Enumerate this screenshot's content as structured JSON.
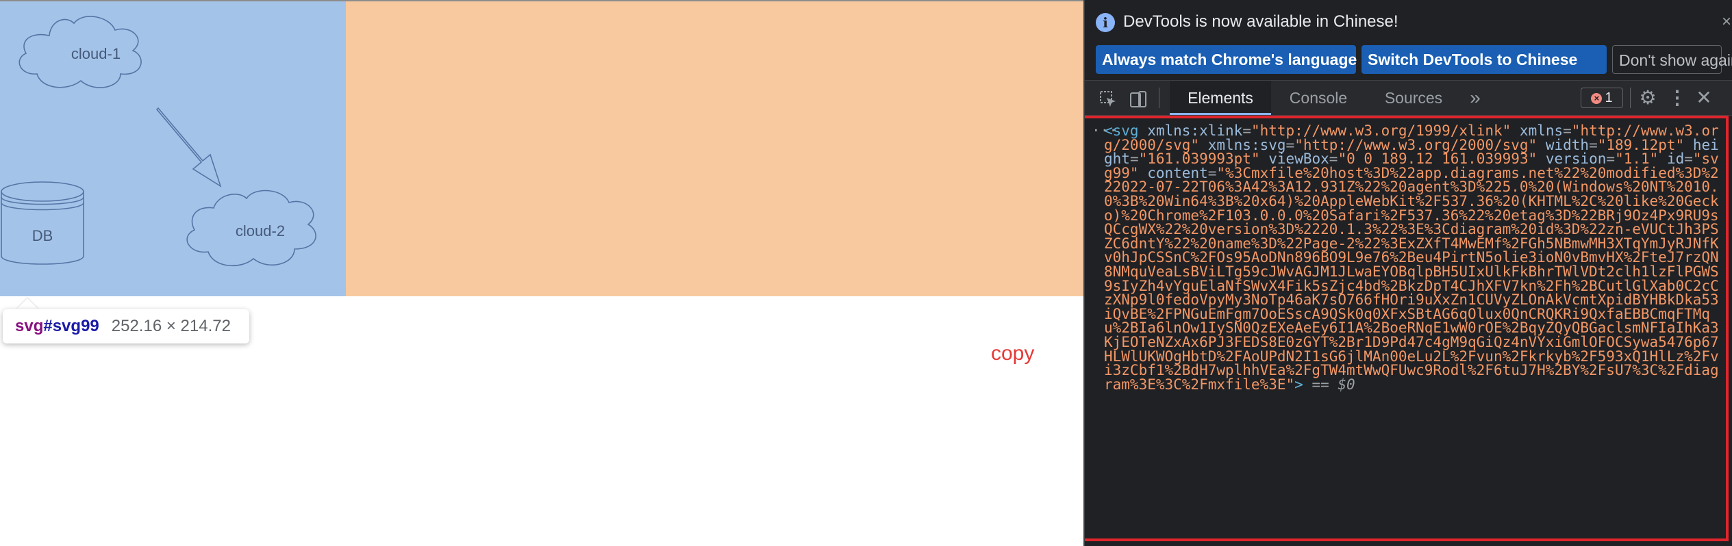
{
  "diagram": {
    "nodes": [
      {
        "label": "cloud-1"
      },
      {
        "label": "DB"
      },
      {
        "label": "cloud-2"
      }
    ]
  },
  "tooltip": {
    "tag": "svg",
    "id": "#svg99",
    "size": "252.16 × 214.72"
  },
  "copy_label": "copy",
  "devtools": {
    "infobar": {
      "message": "DevTools is now available in Chinese!",
      "btn_match": "Always match Chrome's language",
      "btn_switch": "Switch DevTools to Chinese",
      "btn_dont_show": "Don't show again"
    },
    "tabs": [
      "Elements",
      "Console",
      "Sources"
    ],
    "error_count": "1",
    "dom": {
      "ellipsis": "···",
      "tag_open": "<svg",
      "attrs": [
        {
          "name": "xmlns:xlink",
          "value": "\"http://www.w3.org/1999/xlink\""
        },
        {
          "name": "xmlns",
          "value": "\"http://www.w3.org/2000/svg\""
        },
        {
          "name": "xmlns:svg",
          "value": "\"http://www.w3.org/2000/svg\""
        },
        {
          "name": "width",
          "value": "\"189.12pt\""
        },
        {
          "name": "height",
          "value": "\"161.039993pt\""
        },
        {
          "name": "viewBox",
          "value": "\"0 0 189.12 161.039993\""
        },
        {
          "name": "version",
          "value": "\"1.1\""
        },
        {
          "name": "id",
          "value": "\"svg99\""
        },
        {
          "name": "content",
          "value": "\"%3Cmxfile%20host%3D%22app.diagrams.net%22%20modified%3D%222022-07-22T06%3A42%3A12.931Z%22%20agent%3D%225.0%20(Windows%20NT%2010.0%3B%20Win64%3B%20x64)%20AppleWebKit%2F537.36%20(KHTML%2C%20like%20Gecko)%20Chrome%2F103.0.0.0%20Safari%2F537.36%22%20etag%3D%22BRj9Oz4Px9RU9sQCcgWX%22%20version%3D%2220.1.3%22%3E%3Cdiagram%20id%3D%22zn-eVUCtJh3PSZC6dntY%22%20name%3D%22Page-2%22%3ExZXfT4MwEMf%2FGh5NBmwMH3XTqYmJyRJNfKv0hJpCSSnC%2FOs95AoDNn896BO9L9e76%2Beu4PirtN5olie3ioN0vBmvHX%2FteJ7rzQN8NMquVeaLsBViLTg59cJWvAGJM1JLwaEYOBqlpBH5UIxUlkFkBhrTWlVDt2clh1lzFlPGWS9sIyZh4vYguElaNfSWvX4Fik5sZjc4bd%2BkzDpT4CJhXFV7kn%2Fh%2BCutlGlXab0C2cCzXNp9l0fedoVpyMy3NoTp46aK7sO766fHOri9uXxZn1CUVyZLOnAkVcmtXpidBYHBkDka53iQvBE%2FPNGuEmFgm7OoESscA9QSk0q0XFxSBtAG6qOlux0QnCRQKRi9QxfaEBBCmqFTMqu%2BIa6lnOw1IySN0QzEXeAeEy6I1A%2BoeRNqE1wW0rOE%2BqyZQyQBGaclsmNFIaIhKa3KjEOTeNZxAx6PJ3FEDS8E0zGYT%2Br1D9Pd47c4gM9qGiQz4nVYxiGmlOFOCSywa5476p67HLWlUKWOgHbtD%2FAoUPdN2I1sG6jlMAn00eLu2L%2Fvun%2Fkrkyb%2F593xQ1HlLz%2Fvi3zCbf1%2BdH7wplhhVEa%2FgTW4mtWwQFUwc9Rodl%2F6tuJ7H%2BY%2FsU7%3C%2Fdiagram%3E%3C%2Fmxfile%3E\""
        }
      ],
      "tag_close": ">",
      "selected_marker": " == $0"
    }
  }
}
